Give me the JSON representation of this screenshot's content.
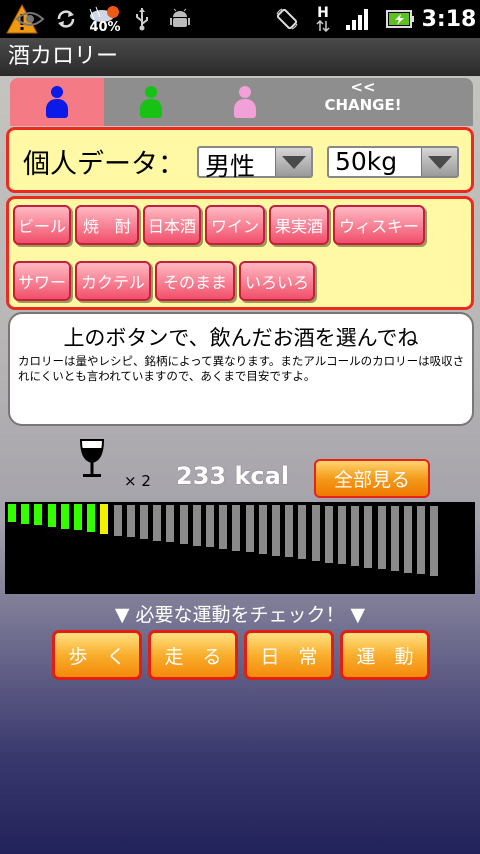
{
  "statusbar": {
    "battery_percent": "40%",
    "clock": "3:18",
    "network_type": "H",
    "icons": [
      "warning-icon",
      "eye-icon",
      "sync-icon",
      "weather-icon",
      "usb-icon",
      "android-icon",
      "rotation-icon",
      "signal-icon",
      "battery-icon"
    ]
  },
  "app": {
    "title": "酒カロリー"
  },
  "tabs": {
    "items": [
      {
        "icon": "person-blue-icon",
        "color": "#0a1ae8"
      },
      {
        "icon": "person-green-icon",
        "color": "#18c214"
      },
      {
        "icon": "person-pink-icon",
        "color": "#f2a0d8"
      }
    ],
    "change_label": "<< CHANGE!"
  },
  "personal": {
    "label": "個人データ：",
    "gender": "男性",
    "weight": "50kg"
  },
  "drinks": [
    "ビール",
    "焼　酎",
    "日本酒",
    "ワイン",
    "果実酒",
    "ウィスキー",
    "サワー",
    "カクテル",
    "そのまま",
    "いろいろ"
  ],
  "info": {
    "title": "上のボタンで、飲んだお酒を選んでね",
    "body": "カロリーは量やレシピ、銘柄によって異なります。またアルコールのカロリーは吸収されにくいとも言われていますので、あくまで目安ですよ。"
  },
  "drink_count": "× 2",
  "calories": "233 kcal",
  "show_all_label": "全部見る",
  "meter": {
    "total_bars": 33,
    "filled_green": 7,
    "filled_yellow": 1,
    "colors": {
      "green": "#34ff00",
      "yellow": "#f2f200",
      "empty": "#8a8a8a"
    }
  },
  "check_label": "▼ 必要な運動をチェック！ ▼",
  "exercise": [
    "歩　く",
    "走　る",
    "日　常",
    "運　動"
  ]
}
